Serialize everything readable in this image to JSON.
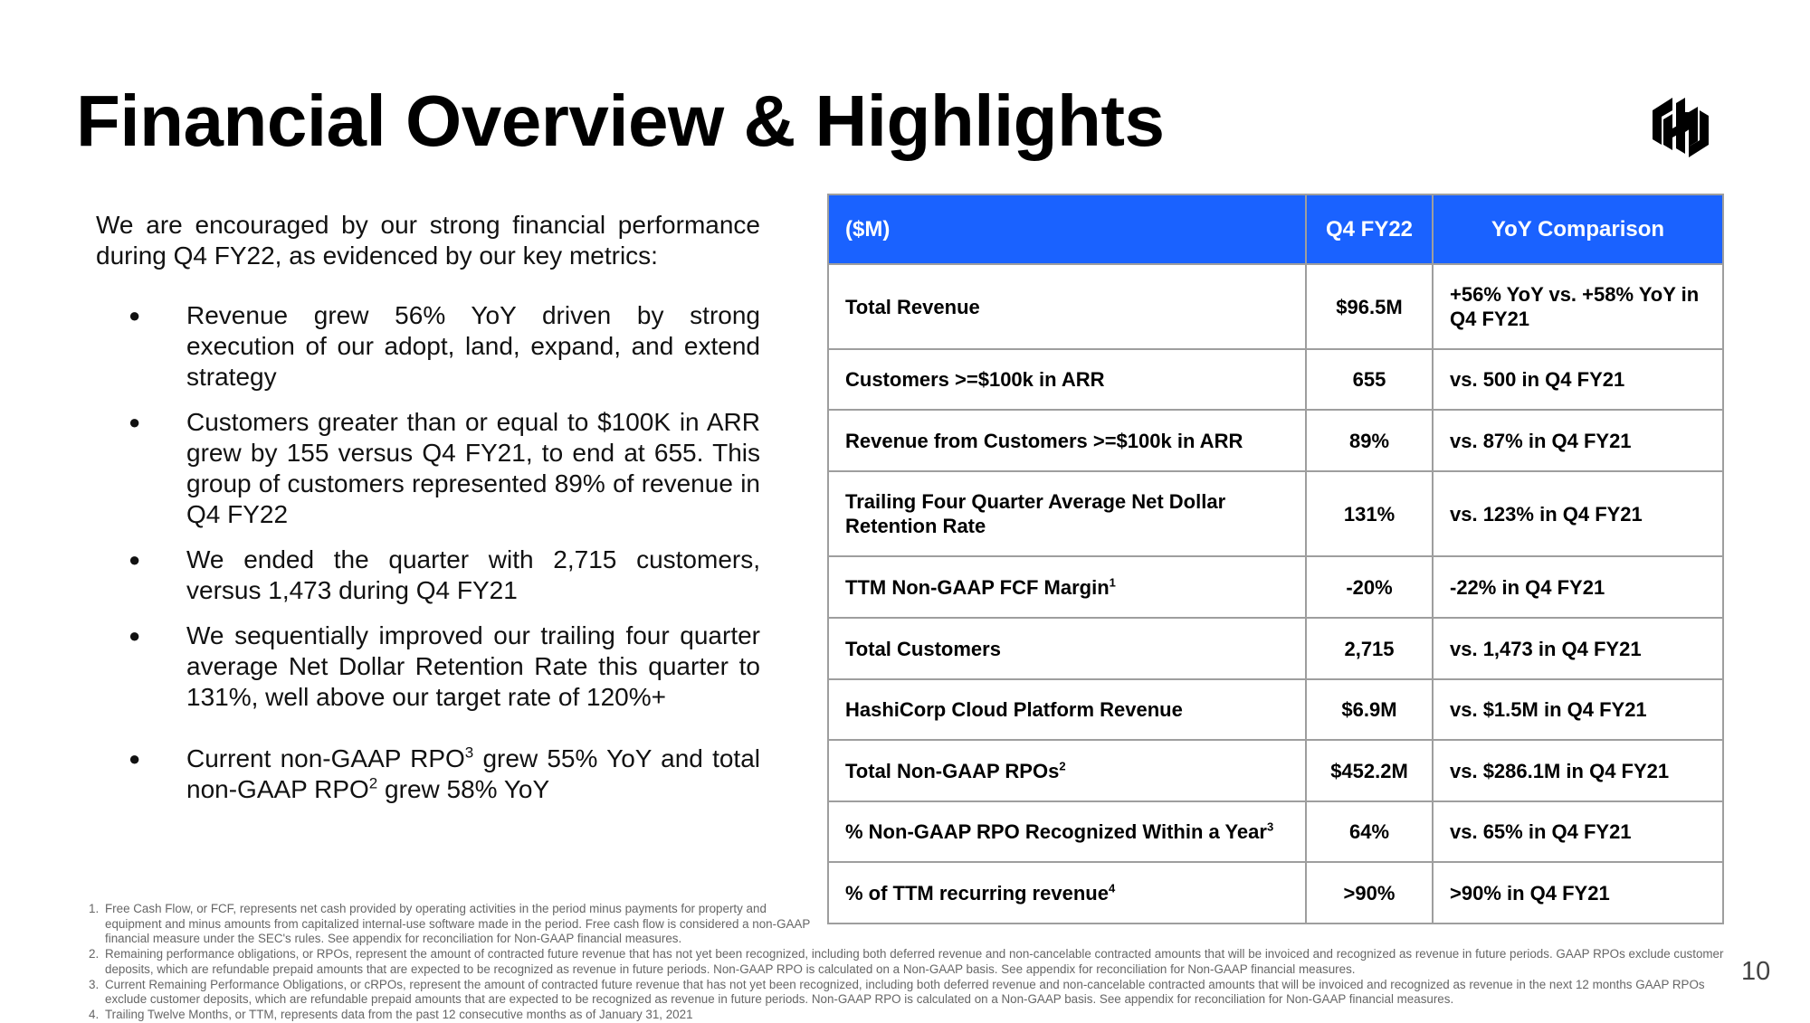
{
  "slide": {
    "title": "Financial Overview & Highlights",
    "logo_icon": "hashicorp-logo-icon",
    "page_number": "10"
  },
  "intro": "We are encouraged by our strong financial performance during Q4 FY22, as evidenced by our key metrics:",
  "bullets": [
    {
      "text": "Revenue grew 56% YoY driven by strong execution of our adopt, land, expand, and extend strategy"
    },
    {
      "text": "Customers greater than or equal to $100K in ARR grew by 155 versus Q4 FY21, to end at 655. This group of customers represented 89% of revenue in Q4 FY22"
    },
    {
      "text": "We ended the quarter with 2,715 customers, versus 1,473 during Q4 FY21"
    },
    {
      "text": "We sequentially improved our trailing four quarter average Net Dollar Retention Rate this quarter to 131%, well above our target rate of 120%+"
    },
    {
      "part1": "Current non-GAAP RPO",
      "sup1": "3",
      "part2": " grew 55% YoY and total non-GAAP RPO",
      "sup2": "2",
      "part3": " grew 58% YoY"
    }
  ],
  "table": {
    "header": [
      "($M)",
      "Q4 FY22",
      "YoY Comparison"
    ],
    "accent_color": "#1a62ff",
    "rows": [
      {
        "metric": "Total Revenue",
        "sup": "",
        "value": "$96.5M",
        "comparison": "+56% YoY vs. +58% YoY in Q4 FY21"
      },
      {
        "metric": "Customers >=$100k in ARR",
        "sup": "",
        "value": "655",
        "comparison": "vs. 500 in Q4 FY21"
      },
      {
        "metric": "Revenue from Customers >=$100k in ARR",
        "sup": "",
        "value": "89%",
        "comparison": "vs. 87% in Q4 FY21"
      },
      {
        "metric": "Trailing Four Quarter Average Net Dollar Retention Rate",
        "sup": "",
        "value": "131%",
        "comparison": "vs. 123% in Q4 FY21"
      },
      {
        "metric": "TTM Non-GAAP FCF Margin",
        "sup": "1",
        "value": "-20%",
        "comparison": "-22% in Q4 FY21"
      },
      {
        "metric": "Total Customers",
        "sup": "",
        "value": "2,715",
        "comparison": "vs.  1,473 in Q4 FY21"
      },
      {
        "metric": "HashiCorp Cloud Platform Revenue",
        "sup": "",
        "value": "$6.9M",
        "comparison": "vs. $1.5M in Q4 FY21"
      },
      {
        "metric": "Total Non-GAAP RPOs",
        "sup": "2",
        "value": "$452.2M",
        "comparison": "vs. $286.1M in Q4 FY21"
      },
      {
        "metric": "% Non-GAAP RPO Recognized Within a Year",
        "sup": "3",
        "value": "64%",
        "comparison": "vs. 65% in Q4 FY21"
      },
      {
        "metric": "% of TTM recurring revenue",
        "sup": "4",
        "value": ">90%",
        "comparison": ">90% in Q4 FY21"
      }
    ]
  },
  "footnotes": [
    {
      "num": "1.",
      "text": "Free Cash Flow, or FCF, represents net cash provided by operating activities in the period minus payments for property and equipment and minus amounts from capitalized internal-use software made in the period. Free cash flow is considered a non-GAAP financial measure under the SEC's rules. See appendix for reconciliation for Non-GAAP financial measures."
    },
    {
      "num": "2.",
      "text": "Remaining performance obligations, or RPOs, represent the amount of contracted future revenue that has not yet been recognized, including both deferred revenue and  non-cancelable contracted  amounts that will be invoiced and recognized as revenue in future periods. GAAP RPOs exclude customer deposits, which are refundable prepaid amounts that are expected to be recognized as revenue in future periods. Non-GAAP RPO is calculated on a Non-GAAP basis. See appendix for reconciliation for Non-GAAP financial measures."
    },
    {
      "num": "3.",
      "text": "Current Remaining Performance Obligations, or cRPOs, represent the amount of contracted future revenue that has not yet been recognized, including both deferred revenue and  non-cancelable contracted amounts that will be invoiced and recognized as revenue in the next 12 months GAAP RPOs exclude customer deposits, which are refundable prepaid amounts that are expected to be recognized as revenue in future periods. Non-GAAP RPO is calculated on a Non-GAAP basis. See appendix for reconciliation for Non-GAAP financial measures."
    },
    {
      "num": "4.",
      "text": "Trailing Twelve Months, or TTM, represents data from the past 12 consecutive months as of January 31, 2021"
    }
  ]
}
